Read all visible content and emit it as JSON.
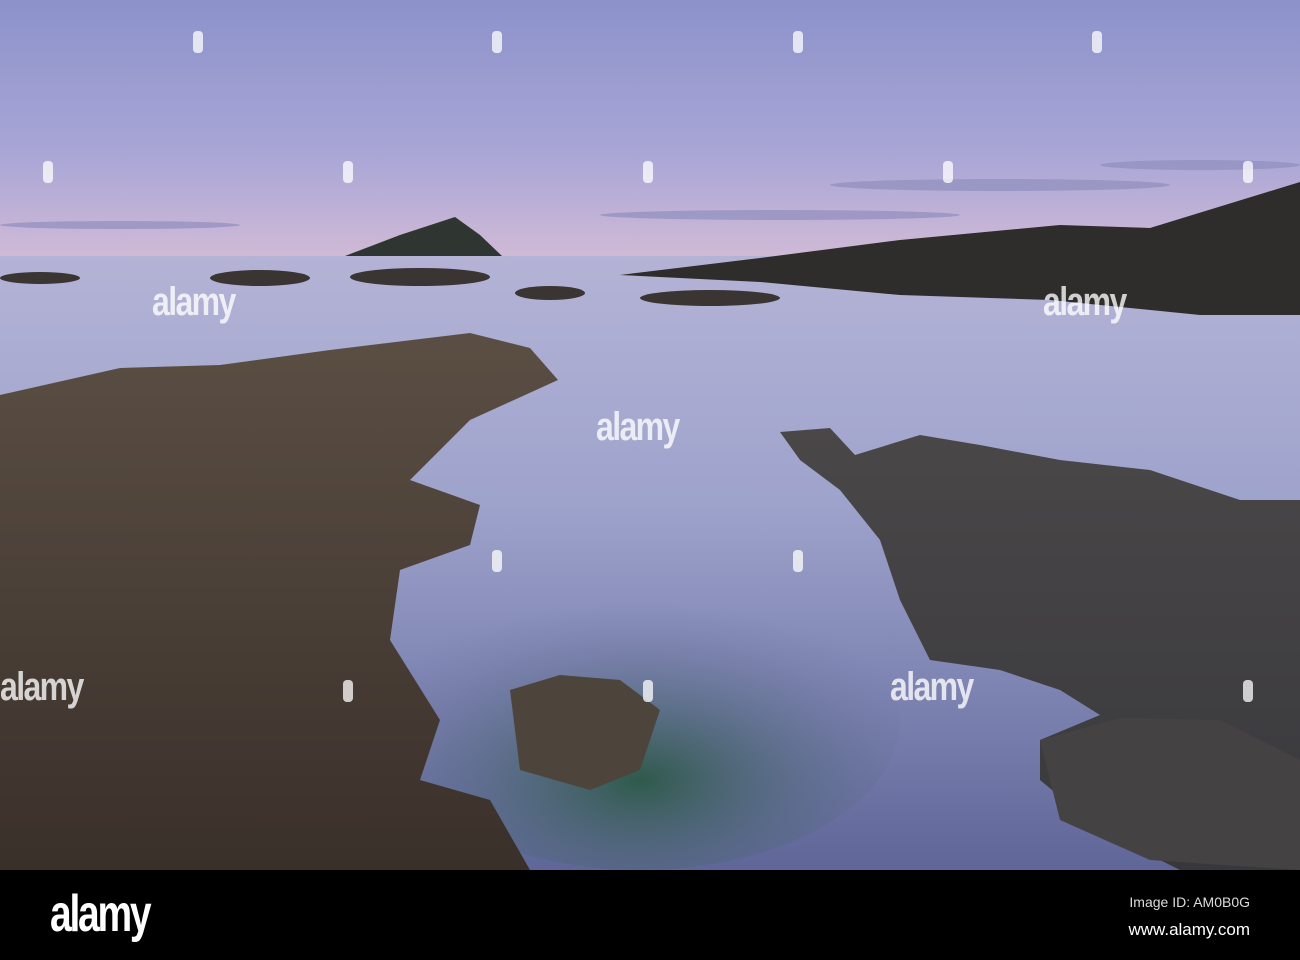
{
  "photo": {
    "subject": "rocky shore at dusk",
    "colors": {
      "sky_top": "#8e95cc",
      "sky_horizon": "#c8b6d8",
      "sea": "#a6a9cf",
      "rock_left": "#4a3f36",
      "rock_right": "#3f3e40",
      "island": "#2f3530"
    }
  },
  "watermark": {
    "text": "alamy"
  },
  "footer": {
    "logo": "alamy",
    "image_id": "Image ID: AM0B0G",
    "url": "www.alamy.com"
  }
}
